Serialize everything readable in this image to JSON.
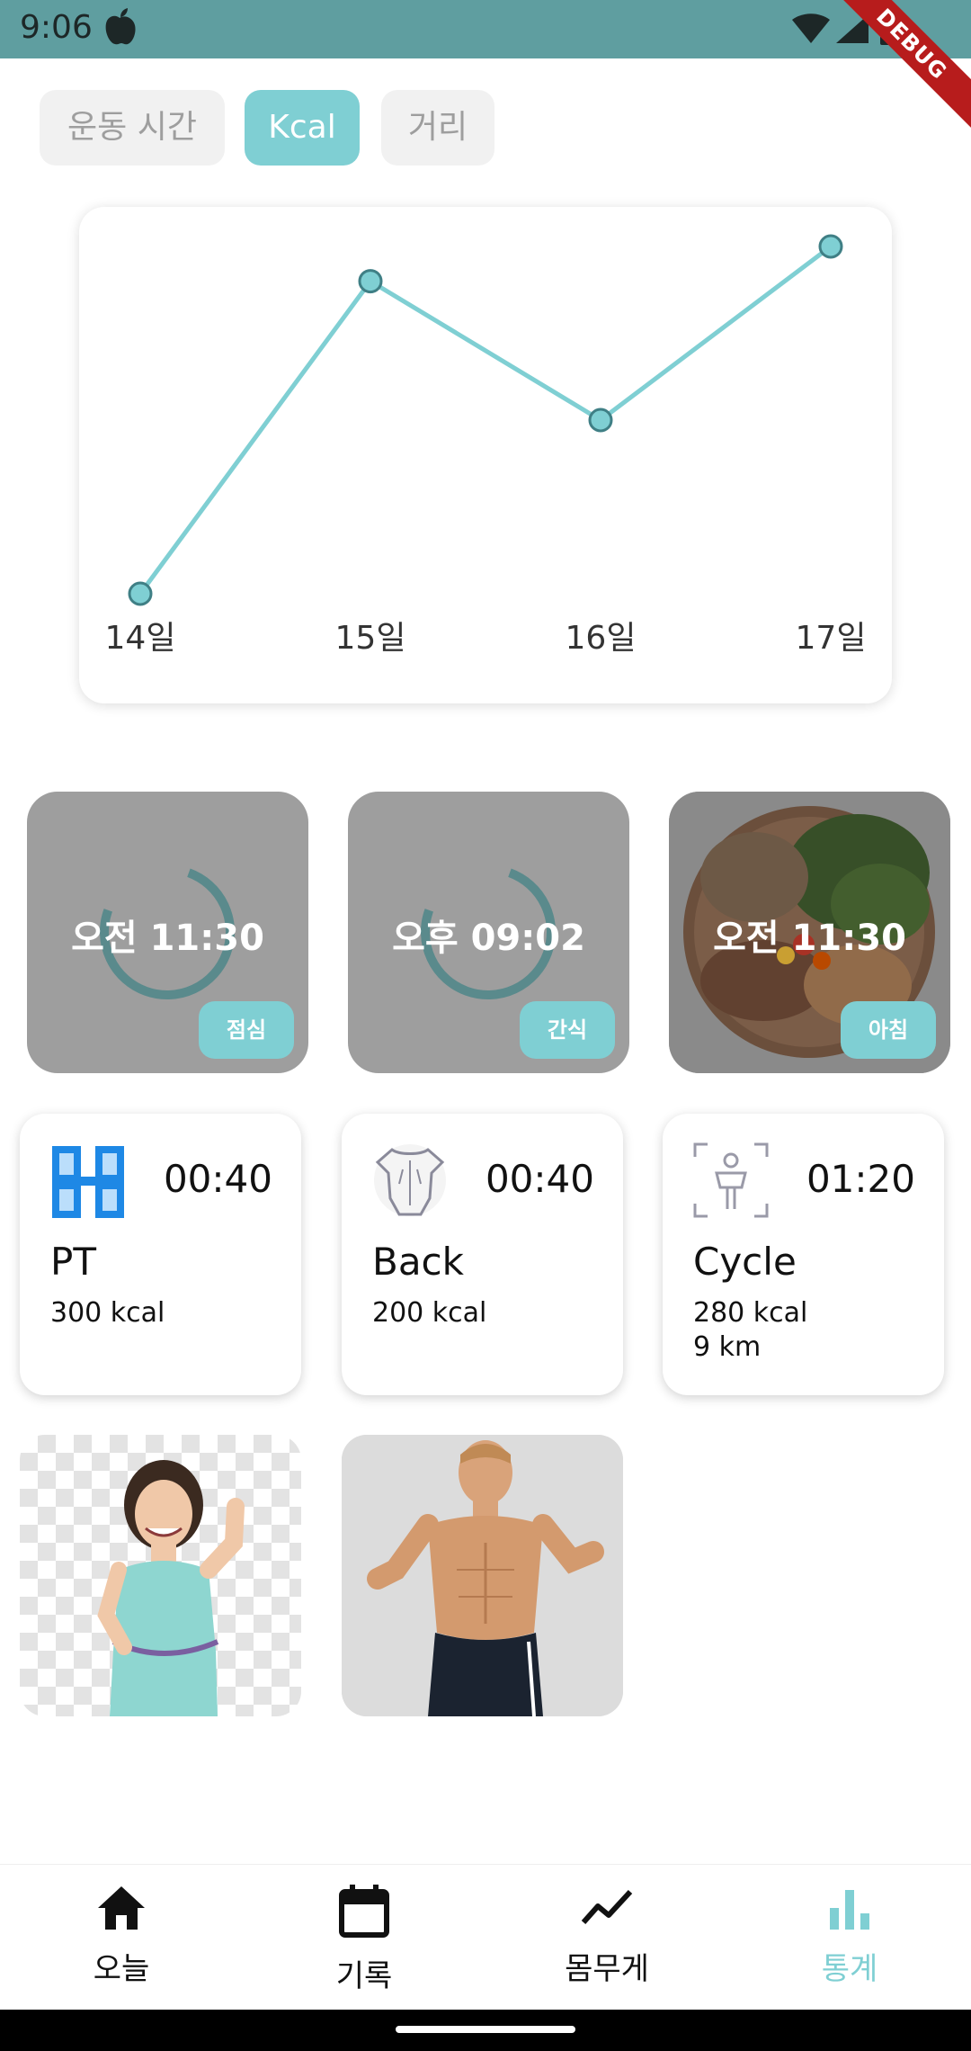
{
  "status_bar": {
    "time": "9:06",
    "debug_label": "DEBUG"
  },
  "tabs": [
    {
      "label": "운동 시간",
      "active": false
    },
    {
      "label": "Kcal",
      "active": true
    },
    {
      "label": "거리",
      "active": false
    }
  ],
  "chart_data": {
    "type": "line",
    "categories": [
      "14일",
      "15일",
      "16일",
      "17일"
    ],
    "values": [
      0,
      90,
      50,
      100
    ],
    "ylim": [
      0,
      100
    ],
    "color": "#7fcfd3",
    "grid": false
  },
  "meals": [
    {
      "time": "오전 11:30",
      "badge": "점심",
      "image": "loading-spinner-icon"
    },
    {
      "time": "오후 09:02",
      "badge": "간식",
      "image": "loading-spinner-icon"
    },
    {
      "time": "오전 11:30",
      "badge": "아침",
      "image": "salad-bowl-photo"
    }
  ],
  "exercises": [
    {
      "name": "PT",
      "duration": "00:40",
      "kcal": "300 kcal",
      "distance": "",
      "icon": "dumbbell-icon"
    },
    {
      "name": "Back",
      "duration": "00:40",
      "kcal": "200 kcal",
      "distance": "",
      "icon": "back-muscle-icon"
    },
    {
      "name": "Cycle",
      "duration": "01:20",
      "kcal": "280 kcal",
      "distance": "9 km",
      "icon": "cycling-icon"
    }
  ],
  "photos": [
    {
      "name": "woman-fitness-photo"
    },
    {
      "name": "man-fitness-photo"
    }
  ],
  "bottom_nav": [
    {
      "label": "오늘",
      "icon": "home-icon",
      "active": false
    },
    {
      "label": "기록",
      "icon": "calendar-icon",
      "active": false
    },
    {
      "label": "몸무게",
      "icon": "trend-line-icon",
      "active": false
    },
    {
      "label": "통계",
      "icon": "bar-chart-icon",
      "active": true
    }
  ],
  "colors": {
    "accent": "#7fcfd3",
    "status_bar": "#5f9ea0",
    "tile_gray": "#9e9e9e"
  }
}
